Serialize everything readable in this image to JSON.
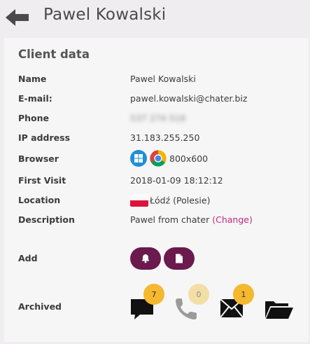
{
  "header": {
    "title": "Pawel Kowalski"
  },
  "section": {
    "title": "Client data"
  },
  "fields": {
    "name": {
      "label": "Name",
      "value": "Pawel Kowalski"
    },
    "email": {
      "label": "E-mail:",
      "value": "pawel.kowalski@chater.biz"
    },
    "phone": {
      "label": "Phone",
      "value": "537 274 516"
    },
    "ip": {
      "label": "IP address",
      "value": "31.183.255.250"
    },
    "browser": {
      "label": "Browser",
      "resolution": "800x600",
      "os_icon": "windows-icon",
      "browser_icon": "chrome-icon"
    },
    "first_visit": {
      "label": "First Visit",
      "value": "2018-01-09 18:12:12"
    },
    "location": {
      "label": "Location",
      "value": "Łódź (Polesie)",
      "flag": "poland-flag"
    },
    "description": {
      "label": "Description",
      "value": "Pawel from chater",
      "change_label": "(Change)"
    },
    "add": {
      "label": "Add",
      "buttons": [
        "bell-icon",
        "file-icon"
      ]
    },
    "archived": {
      "label": "Archived",
      "items": [
        {
          "icon": "chat-icon",
          "count": "7"
        },
        {
          "icon": "phone-icon",
          "count": "0"
        },
        {
          "icon": "envelope-icon",
          "count": "1"
        },
        {
          "icon": "folder-open-icon"
        }
      ]
    }
  },
  "colors": {
    "accent": "#6b1a4e",
    "link": "#c0287e",
    "badge_active": "#f5b82e",
    "badge_inactive": "#f3dfa6"
  }
}
